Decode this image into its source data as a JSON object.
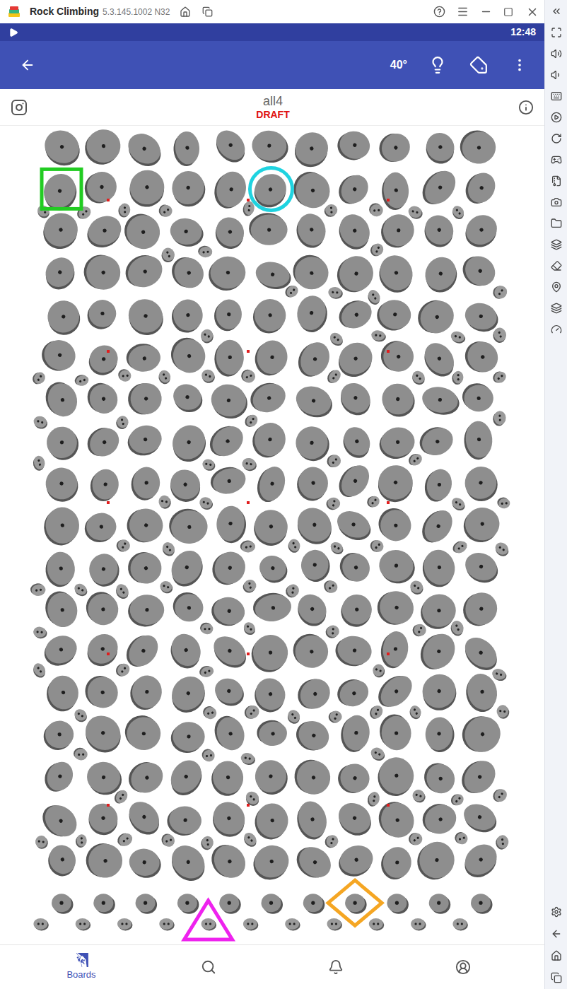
{
  "window": {
    "title": "Rock Climbing",
    "version": "5.3.145.1002 N32"
  },
  "status_bar": {
    "time": "12:48"
  },
  "app_bar": {
    "angle": "40°"
  },
  "problem": {
    "name": "all4",
    "status": "DRAFT"
  },
  "markers": [
    {
      "kind": "square",
      "color": "#22cc22",
      "row": 1,
      "col": 0
    },
    {
      "kind": "circle",
      "color": "#1fd3e0",
      "row": 1,
      "col": 5
    },
    {
      "kind": "triangle",
      "color": "#ee22ee",
      "row": 18.5,
      "col": 3.5
    },
    {
      "kind": "diamond",
      "color": "#f5a623",
      "row": 18,
      "col": 7
    }
  ],
  "nav": [
    {
      "label": "Boards",
      "selected": true
    },
    {
      "selected": false
    },
    {
      "selected": false
    },
    {
      "selected": false
    }
  ]
}
